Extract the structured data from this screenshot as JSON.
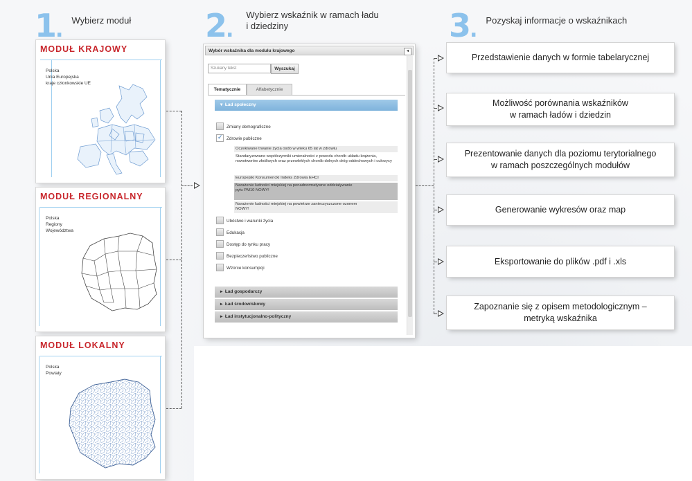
{
  "steps": [
    {
      "number": "1",
      "title": "Wybierz moduł"
    },
    {
      "number": "2",
      "title_line1": "Wybierz wskaźnik w ramach ładu",
      "title_line2": "i dziedziny"
    },
    {
      "number": "3",
      "title": "Pozyskaj informacje o wskaźnikach"
    }
  ],
  "modules": [
    {
      "title": "MODUŁ KRAJOWY",
      "lines": [
        "Polska",
        "Unia Europejska",
        "kraje członkowskie UE"
      ]
    },
    {
      "title": "MODUŁ REGIONALNY",
      "lines": [
        "Polska",
        "Regiony",
        "Województwa"
      ]
    },
    {
      "title": "MODUŁ LOKALNY",
      "lines": [
        "Polska",
        "Powiaty"
      ]
    }
  ],
  "panel": {
    "header": "Wybór wskaźnika dla modułu krajowego",
    "search_placeholder": "Szukany tekst",
    "search_button": "Wyszukaj",
    "tabs": [
      "Tematycznie",
      "Alfabetycznie"
    ],
    "open_section": "Ład społeczny",
    "categories": [
      "Zmiany demograficzne",
      "Zdrowie publiczne",
      "Ubóstwo i warunki życia",
      "Edukacja",
      "Dostęp do rynku pracy",
      "Bezpieczeństwo publiczne",
      "Wzorce konsumpcji"
    ],
    "indicators": [
      "Oczekiwane trwanie życia osób w wieku 65 lat w zdrowiu",
      "Standaryzowane współczynniki umieralności z powodu chorób układu krążenia, nowotworów złośliwych oraz przewlekłych chorób dolnych dróg oddechowych i cukrzycy",
      "Europejski Konsumencki Indeks Zdrowia EHCI",
      "Narażenie ludności miejskiej na ponadnormatywne oddziaływanie pyłu PM10 NOWY!",
      "Narażenie ludności miejskiej na powietrze zanieczyszczone ozonem NOWY!"
    ],
    "closed_sections": [
      "Ład gospodarczy",
      "Ład środowiskowy",
      "Ład instytucjonalno-polityczny"
    ]
  },
  "info_boxes": [
    {
      "line1": "Przedstawienie danych w formie tabelarycznej",
      "line2": ""
    },
    {
      "line1": "Możliwość porównania wskaźników",
      "line2": "w ramach ładów i dziedzin"
    },
    {
      "line1": "Prezentowanie danych dla poziomu terytorialnego",
      "line2": "w ramach poszczególnych modułów"
    },
    {
      "line1": "Generowanie wykresów oraz map",
      "line2": ""
    },
    {
      "line1": "Eksportowanie do plików .pdf i .xls",
      "line2": ""
    },
    {
      "line1": "Zapoznanie się z opisem metodologicznym –",
      "line2": "metryką wskaźnika"
    }
  ],
  "colors": {
    "accent": "#8cc2ec",
    "module_title": "#c8262c",
    "section_open": "#7fb3dc"
  }
}
